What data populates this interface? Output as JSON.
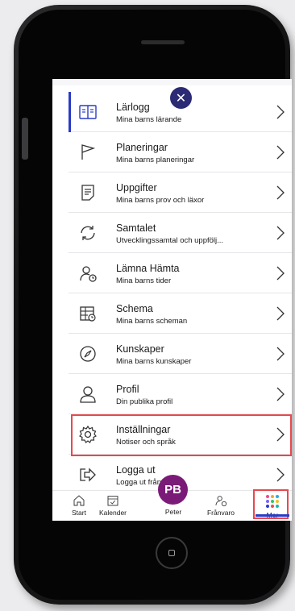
{
  "close_glyph": "✕",
  "menu": [
    {
      "title": "Lärlogg",
      "subtitle": "Mina barns lärande",
      "icon": "book-icon",
      "active": true
    },
    {
      "title": "Planeringar",
      "subtitle": "Mina barns planeringar",
      "icon": "flag-icon"
    },
    {
      "title": "Uppgifter",
      "subtitle": "Mina barns prov och läxor",
      "icon": "document-icon"
    },
    {
      "title": "Samtalet",
      "subtitle": "Utvecklingssamtal och uppfölj...",
      "icon": "refresh-icon"
    },
    {
      "title": "Lämna Hämta",
      "subtitle": "Mina barns tider",
      "icon": "person-clock-icon"
    },
    {
      "title": "Schema",
      "subtitle": "Mina barns scheman",
      "icon": "schedule-icon"
    },
    {
      "title": "Kunskaper",
      "subtitle": "Mina barns kunskaper",
      "icon": "compass-icon"
    },
    {
      "title": "Profil",
      "subtitle": "Din publika profil",
      "icon": "person-icon"
    },
    {
      "title": "Inställningar",
      "subtitle": "Notiser och språk",
      "icon": "gear-icon",
      "highlighted": true
    },
    {
      "title": "Logga ut",
      "subtitle": "Logga ut från",
      "icon": "logout-icon"
    }
  ],
  "tabs": {
    "start": "Start",
    "kalender": "Kalender",
    "profile_initials": "PB",
    "profile_name": "Peter",
    "franvaro": "Frånvaro",
    "mer": "Mer"
  },
  "colors": {
    "accent": "#2a3bc7",
    "avatar": "#7b1b78",
    "close_button": "#2b2a74",
    "highlight": "#e6494f"
  },
  "dot_colors": [
    "#e94e8a",
    "#f6a623",
    "#2ea8e0",
    "#7b61ff",
    "#34c46a",
    "#f2c21b",
    "#2a3bc7",
    "#e94e4e",
    "#1fb5a8"
  ]
}
